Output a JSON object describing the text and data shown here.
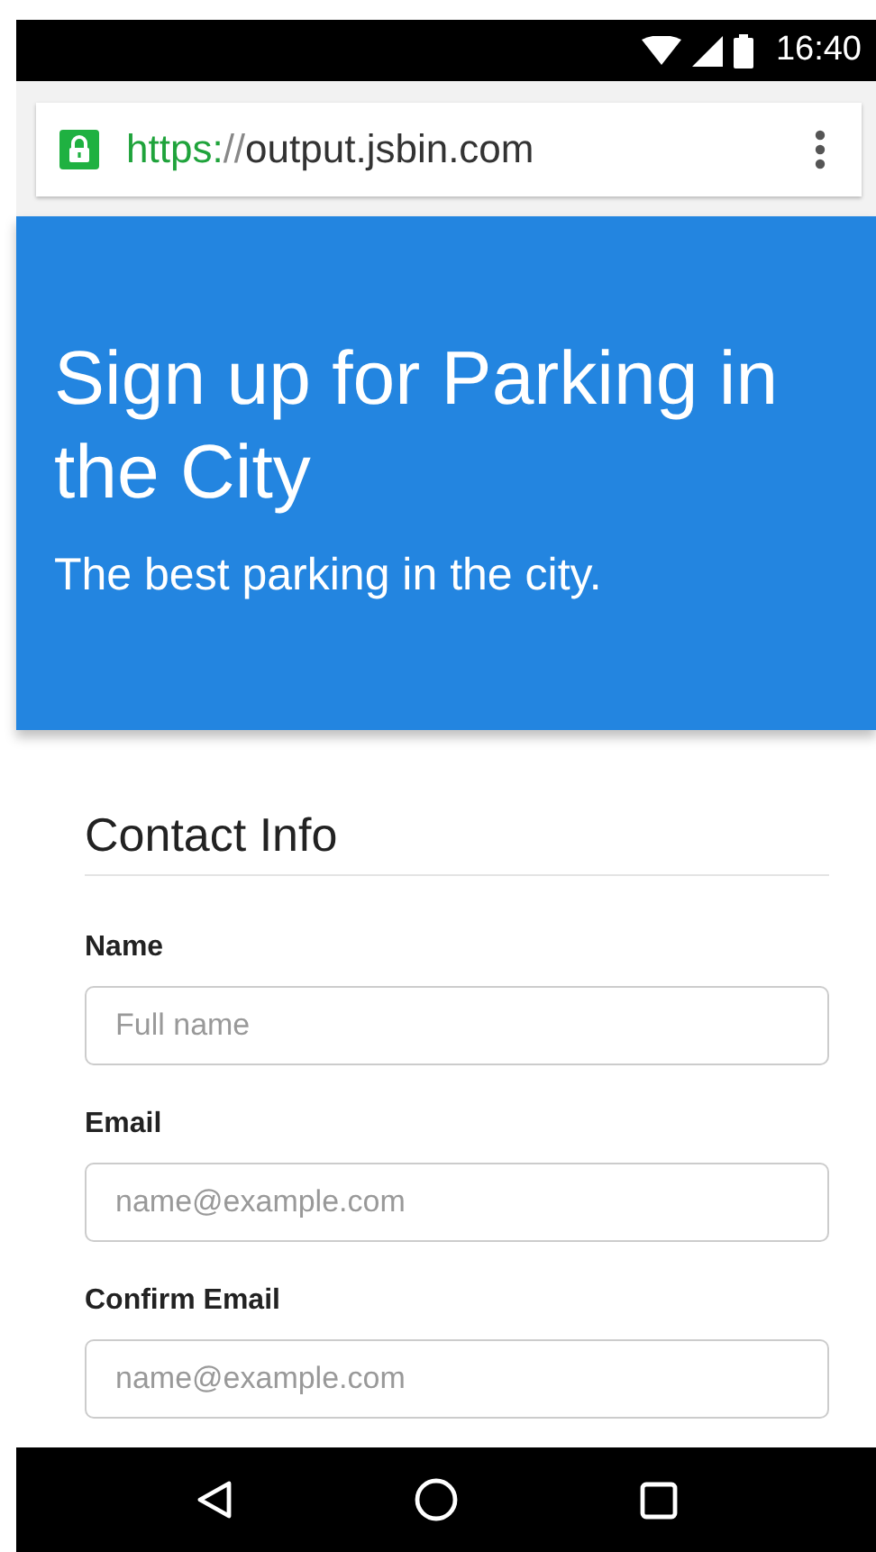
{
  "status_bar": {
    "time": "16:40"
  },
  "address_bar": {
    "secure": true,
    "scheme": "https:",
    "separator": "//",
    "host": "output.jsbin.com"
  },
  "header": {
    "title": "Sign up for Parking in the City",
    "subtitle": "The best parking in the city."
  },
  "form": {
    "section_title": "Contact Info",
    "fields": [
      {
        "label": "Name",
        "placeholder": "Full name"
      },
      {
        "label": "Email",
        "placeholder": "name@example.com"
      },
      {
        "label": "Confirm Email",
        "placeholder": "name@example.com"
      }
    ]
  }
}
